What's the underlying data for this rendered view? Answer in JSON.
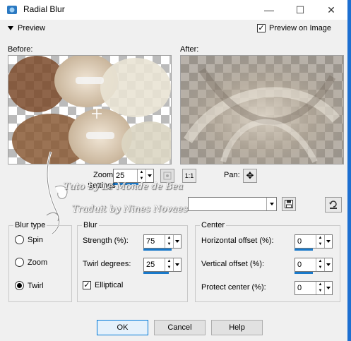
{
  "window": {
    "title": "Radial Blur",
    "minimize_glyph": "—",
    "maximize_glyph": "☐",
    "close_glyph": "✕"
  },
  "preview": {
    "toggle_label": "Preview",
    "preview_on_image_label": "Preview on Image",
    "preview_on_image_checked": true,
    "before_label": "Before:",
    "after_label": "After:"
  },
  "zoom": {
    "label": "Zoom:",
    "value": "25",
    "actual_size_label": "1:1",
    "pan_label": "Pan:"
  },
  "settings": {
    "label": "Settings",
    "value": ""
  },
  "blur_type": {
    "title": "Blur type",
    "options": [
      "Spin",
      "Zoom",
      "Twirl"
    ],
    "selected": "Twirl"
  },
  "blur": {
    "title": "Blur",
    "strength_label": "Strength (%):",
    "strength_value": "75",
    "twirl_label": "Twirl degrees:",
    "twirl_value": "25",
    "elliptical_label": "Elliptical",
    "elliptical_checked": true
  },
  "center": {
    "title": "Center",
    "h_offset_label": "Horizontal offset (%):",
    "h_offset_value": "0",
    "v_offset_label": "Vertical offset (%):",
    "v_offset_value": "0",
    "protect_label": "Protect center (%):",
    "protect_value": "0"
  },
  "buttons": {
    "ok": "OK",
    "cancel": "Cancel",
    "help": "Help"
  },
  "watermark": {
    "line1": "Tuto by Le Monde de Bea",
    "line2": "Traduit by Nines Novaes"
  },
  "colors": {
    "accent": "#0078d7",
    "titlebar": "#ffffff",
    "dialog_bg": "#f0f0f0",
    "window_edge": "#1d6fd1"
  }
}
